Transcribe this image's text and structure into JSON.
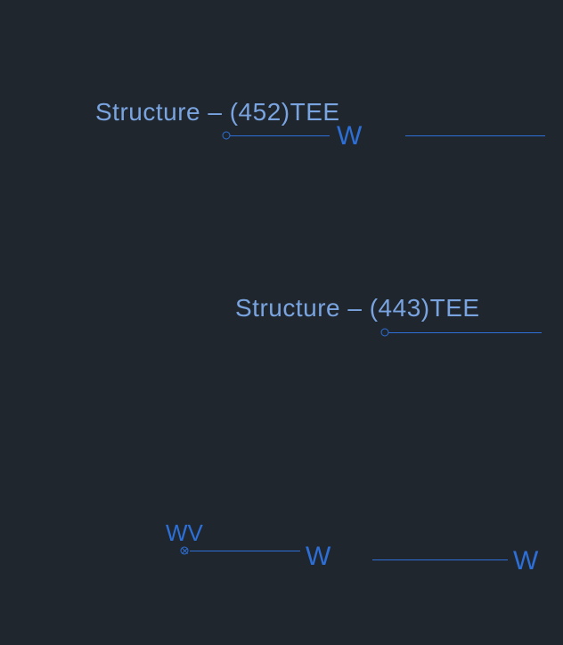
{
  "structures": [
    {
      "id": 452,
      "label": "Structure – (452)TEE"
    },
    {
      "id": 443,
      "label": "Structure – (443)TEE"
    }
  ],
  "markers": {
    "w": "W",
    "wv": "WV"
  }
}
